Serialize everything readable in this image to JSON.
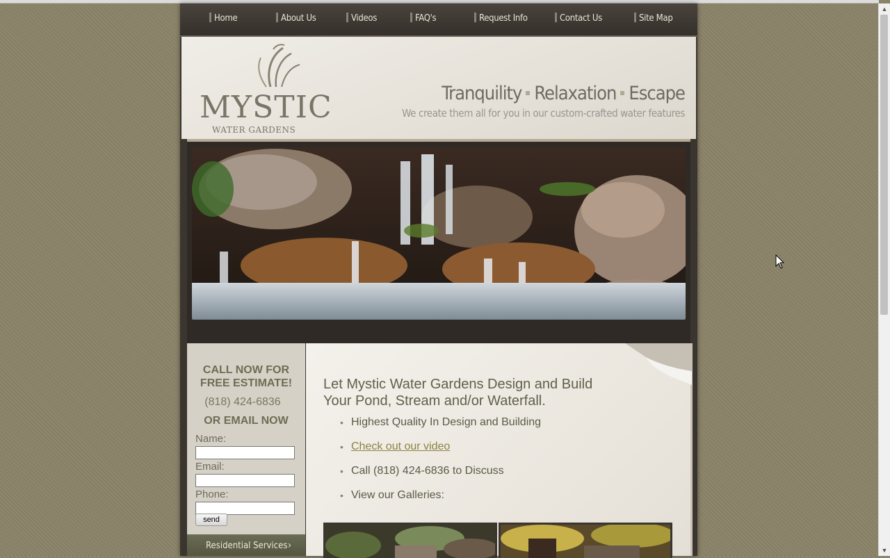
{
  "nav": {
    "items": [
      {
        "label": "Home"
      },
      {
        "label": "About Us"
      },
      {
        "label": "Videos"
      },
      {
        "label": "FAQ's"
      },
      {
        "label": "Request Info"
      },
      {
        "label": "Contact Us"
      },
      {
        "label": "Site Map"
      }
    ]
  },
  "header": {
    "logo_word": "MYSTIC",
    "logo_sub": "WATER GARDENS",
    "tagline_words": [
      "Tranquility",
      "Relaxation",
      "Escape"
    ],
    "tagline_sub": "We create them all for you in our custom-crafted water features"
  },
  "sidebar": {
    "call_title_1": "CALL NOW FOR",
    "call_title_2": "FREE ESTIMATE!",
    "phone": "(818) 424-6836",
    "email_title": "OR EMAIL NOW",
    "name_label": "Name:",
    "email_label": "Email:",
    "phone_label": "Phone:",
    "name_value": "",
    "email_value": "",
    "phone_value": "",
    "send_label": "send",
    "residential_label": "Residential Services",
    "residential_arrow": "›"
  },
  "main": {
    "headline_1": "Let Mystic Water Gardens Design and Build",
    "headline_2": "Your Pond, Stream and/or Waterfall.",
    "bullets": [
      {
        "text": "Highest Quality In Design and Building"
      },
      {
        "text": "Check out our video"
      },
      {
        "text": "Call (818) 424-6836 to Discuss"
      },
      {
        "text": "View our Galleries:"
      }
    ]
  },
  "colors": {
    "background": "#8a8268",
    "nav_bg": "#3b3530",
    "accent_text": "#60604a",
    "link": "#8a8342"
  },
  "icons": {
    "scroll_up": "▲",
    "scroll_down": "▼",
    "bullet": "•"
  }
}
